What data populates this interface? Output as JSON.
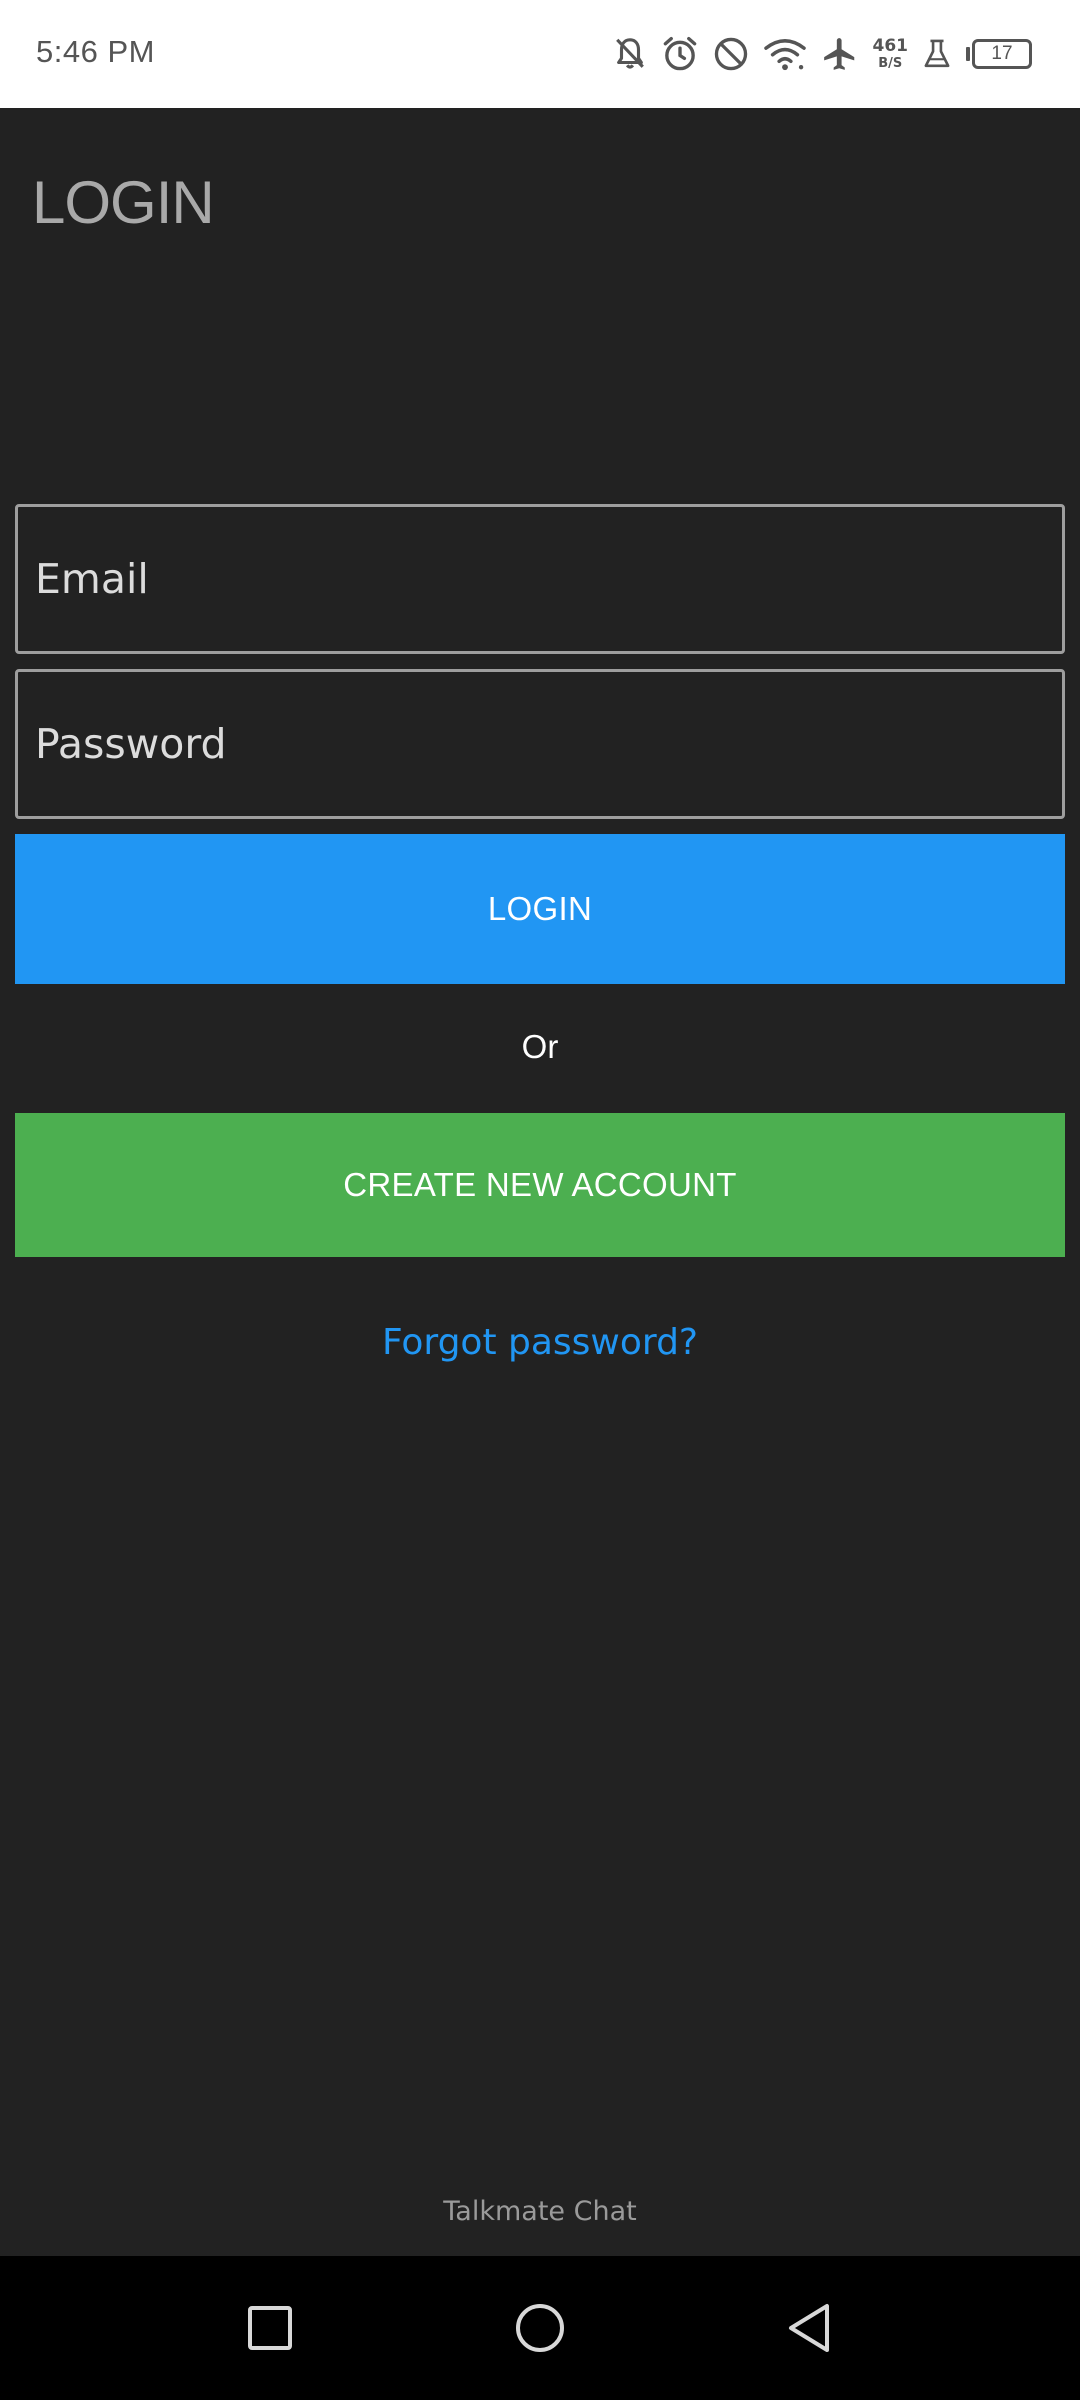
{
  "status_bar": {
    "time": "5:46 PM",
    "net_speed_value": "461",
    "net_speed_unit": "B/S",
    "battery_level": "17",
    "icons": [
      "notifications-off-icon",
      "alarm-icon",
      "do-not-disturb-icon",
      "wifi-icon",
      "airplane-mode-icon",
      "lab-flask-icon",
      "battery-icon"
    ]
  },
  "header": {
    "title": "LOGIN"
  },
  "form": {
    "email_placeholder": "Email",
    "password_placeholder": "Password",
    "login_label": "LOGIN",
    "or_label": "Or",
    "create_account_label": "CREATE NEW ACCOUNT",
    "forgot_password_label": "Forgot password?"
  },
  "footer": {
    "app_name": "Talkmate Chat"
  },
  "nav_bar": {
    "icons": [
      "recents-square-icon",
      "home-circle-icon",
      "back-triangle-icon"
    ]
  },
  "colors": {
    "background": "#222222",
    "login_button": "#2196f3",
    "create_button": "#4caf50",
    "link": "#2196f3",
    "title": "#a9a9a9"
  }
}
